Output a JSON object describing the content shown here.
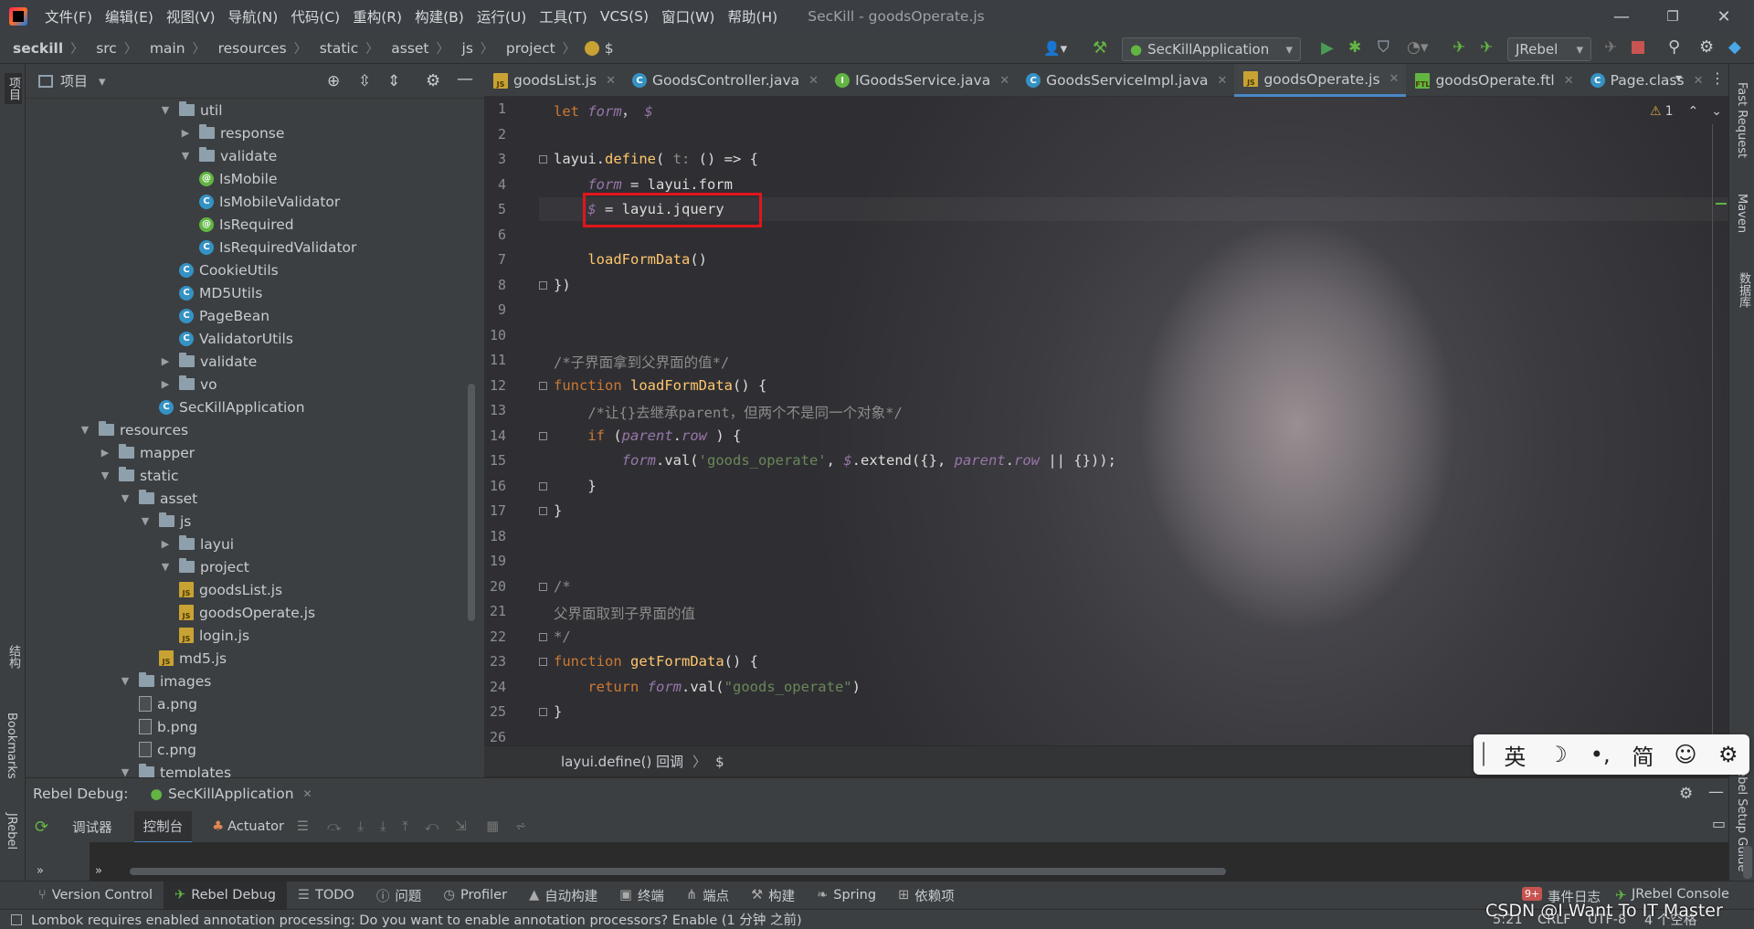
{
  "menu": [
    "文件(F)",
    "编辑(E)",
    "视图(V)",
    "导航(N)",
    "代码(C)",
    "重构(R)",
    "构建(B)",
    "运行(U)",
    "工具(T)",
    "VCS(S)",
    "窗口(W)",
    "帮助(H)"
  ],
  "window_title": "SecKill - goodsOperate.js",
  "breadcrumb": [
    "seckill",
    "src",
    "main",
    "resources",
    "static",
    "asset",
    "js",
    "project",
    "$"
  ],
  "run_config": "SecKillApplication",
  "jrebel_select": "JRebel",
  "project_panel": {
    "title": "项目"
  },
  "tree": [
    {
      "label": "util",
      "depth": 7,
      "type": "folder",
      "arrow": "down"
    },
    {
      "label": "response",
      "depth": 8,
      "type": "folder",
      "arrow": "right"
    },
    {
      "label": "validate",
      "depth": 8,
      "type": "folder",
      "arrow": "down"
    },
    {
      "label": "IsMobile",
      "depth": 9,
      "type": "annotation"
    },
    {
      "label": "IsMobileValidator",
      "depth": 9,
      "type": "class"
    },
    {
      "label": "IsRequired",
      "depth": 9,
      "type": "annotation"
    },
    {
      "label": "IsRequiredValidator",
      "depth": 9,
      "type": "class"
    },
    {
      "label": "CookieUtils",
      "depth": 8,
      "type": "class"
    },
    {
      "label": "MD5Utils",
      "depth": 8,
      "type": "class"
    },
    {
      "label": "PageBean",
      "depth": 8,
      "type": "class"
    },
    {
      "label": "ValidatorUtils",
      "depth": 8,
      "type": "class"
    },
    {
      "label": "validate",
      "depth": 7,
      "type": "folder",
      "arrow": "right"
    },
    {
      "label": "vo",
      "depth": 7,
      "type": "folder",
      "arrow": "right"
    },
    {
      "label": "SecKillApplication",
      "depth": 7,
      "type": "class"
    },
    {
      "label": "resources",
      "depth": 3,
      "type": "folder",
      "arrow": "down"
    },
    {
      "label": "mapper",
      "depth": 4,
      "type": "folder",
      "arrow": "right"
    },
    {
      "label": "static",
      "depth": 4,
      "type": "folder",
      "arrow": "down"
    },
    {
      "label": "asset",
      "depth": 5,
      "type": "folder",
      "arrow": "down"
    },
    {
      "label": "js",
      "depth": 6,
      "type": "folder",
      "arrow": "down"
    },
    {
      "label": "layui",
      "depth": 7,
      "type": "folder",
      "arrow": "right"
    },
    {
      "label": "project",
      "depth": 7,
      "type": "folder",
      "arrow": "down"
    },
    {
      "label": "goodsList.js",
      "depth": 8,
      "type": "js"
    },
    {
      "label": "goodsOperate.js",
      "depth": 8,
      "type": "js"
    },
    {
      "label": "login.js",
      "depth": 8,
      "type": "js"
    },
    {
      "label": "md5.js",
      "depth": 7,
      "type": "js"
    },
    {
      "label": "images",
      "depth": 5,
      "type": "folder",
      "arrow": "down"
    },
    {
      "label": "a.png",
      "depth": 6,
      "type": "png"
    },
    {
      "label": "b.png",
      "depth": 6,
      "type": "png"
    },
    {
      "label": "c.png",
      "depth": 6,
      "type": "png"
    },
    {
      "label": "templates",
      "depth": 5,
      "type": "folder",
      "arrow": "down"
    }
  ],
  "tabs": [
    {
      "label": "goodsList.js",
      "icon": "js",
      "active": false
    },
    {
      "label": "GoodsController.java",
      "icon": "class",
      "active": false
    },
    {
      "label": "IGoodsService.java",
      "icon": "interface",
      "active": false
    },
    {
      "label": "GoodsServiceImpl.java",
      "icon": "class",
      "active": false
    },
    {
      "label": "goodsOperate.js",
      "icon": "js",
      "active": true
    },
    {
      "label": "goodsOperate.ftl",
      "icon": "ftl",
      "active": false
    },
    {
      "label": "Page.class",
      "icon": "class",
      "active": false
    }
  ],
  "code_lines": [
    [
      [
        "kw",
        "let "
      ],
      [
        "vr",
        "form"
      ],
      [
        "",
        "， "
      ],
      [
        "vr",
        "$"
      ]
    ],
    [],
    [
      [
        "",
        "layui."
      ],
      [
        "fn",
        "define"
      ],
      [
        "",
        "( "
      ],
      [
        "cm",
        "t:"
      ],
      [
        "",
        " () => {"
      ]
    ],
    [
      [
        "",
        ""
      ],
      [
        "vr",
        "    form"
      ],
      [
        "",
        " = layui.form"
      ]
    ],
    [
      [
        "vr",
        "    $"
      ],
      [
        "",
        " = layui.jquery"
      ]
    ],
    [],
    [
      [
        "fn",
        "    loadFormData"
      ],
      [
        "",
        "()"
      ]
    ],
    [
      [
        "",
        "})"
      ]
    ],
    [],
    [],
    [
      [
        "cm",
        "/*子界面拿到父界面的值*/"
      ]
    ],
    [
      [
        "kw",
        "function "
      ],
      [
        "fn",
        "loadFormData"
      ],
      [
        "",
        "() {"
      ]
    ],
    [
      [
        "cm",
        "    /*让{}去继承parent，但两个不是同一个对象*/"
      ]
    ],
    [
      [
        "kw",
        "    if "
      ],
      [
        "",
        "("
      ],
      [
        "vr",
        "parent"
      ],
      [
        "",
        "."
      ],
      [
        "vr",
        "row"
      ],
      [
        "",
        " ) {"
      ]
    ],
    [
      [
        "vr",
        "        form"
      ],
      [
        "",
        ".val("
      ],
      [
        "str",
        "'goods_operate'"
      ],
      [
        "",
        ", "
      ],
      [
        "vr",
        "$"
      ],
      [
        "",
        ".extend({}, "
      ],
      [
        "vr",
        "parent"
      ],
      [
        "",
        "."
      ],
      [
        "vr",
        "row"
      ],
      [
        "",
        " || {}));"
      ]
    ],
    [
      [
        "",
        "    }"
      ]
    ],
    [
      [
        "",
        "}"
      ]
    ],
    [],
    [],
    [
      [
        "cm",
        "/*"
      ]
    ],
    [
      [
        "cm",
        "父界面取到子界面的值"
      ]
    ],
    [
      [
        "cm",
        "*/"
      ]
    ],
    [
      [
        "kw",
        "function "
      ],
      [
        "fn",
        "getFormData"
      ],
      [
        "",
        "() {"
      ]
    ],
    [
      [
        "kw",
        "    return "
      ],
      [
        "vr",
        "form"
      ],
      [
        "",
        ".val("
      ],
      [
        "str",
        "\"goods_operate\""
      ],
      [
        "",
        ")"
      ]
    ],
    [
      [
        "",
        "}"
      ]
    ],
    []
  ],
  "editor_status": {
    "warnings": "1",
    "breadcrumb": [
      "layui.define() 回调",
      "$"
    ]
  },
  "debug": {
    "label": "Rebel Debug:",
    "session": "SecKillApplication",
    "tabs": [
      "调试器",
      "控制台",
      "Actuator"
    ]
  },
  "tool_windows": [
    "Version Control",
    "Rebel Debug",
    "TODO",
    "问题",
    "Profiler",
    "自动构建",
    "终端",
    "端点",
    "构建",
    "Spring",
    "依赖项"
  ],
  "event_log": {
    "badge": "9+",
    "label": "事件日志"
  },
  "jrebel_console": "JRebel Console",
  "status": {
    "message": "Lombok requires enabled annotation processing: Do you want to enable annotation processors? Enable (1 分钟 之前)",
    "position": "5:21",
    "line_sep": "CRLF",
    "encoding": "UTF-8",
    "indent": "4 个空格"
  },
  "watermark": "CSDN @I Want To IT Master",
  "ime": [
    "英",
    "☽",
    "•,",
    "简",
    "☺",
    "⚙"
  ],
  "side_labels": {
    "left_top": "项目",
    "left_struct": "结构",
    "bookmarks": "Bookmarks",
    "jrebel": "JRebel",
    "fast_request": "Fast Request",
    "maven": "Maven",
    "database": "数据库",
    "setup_guide": "JRebel Setup Guide"
  }
}
